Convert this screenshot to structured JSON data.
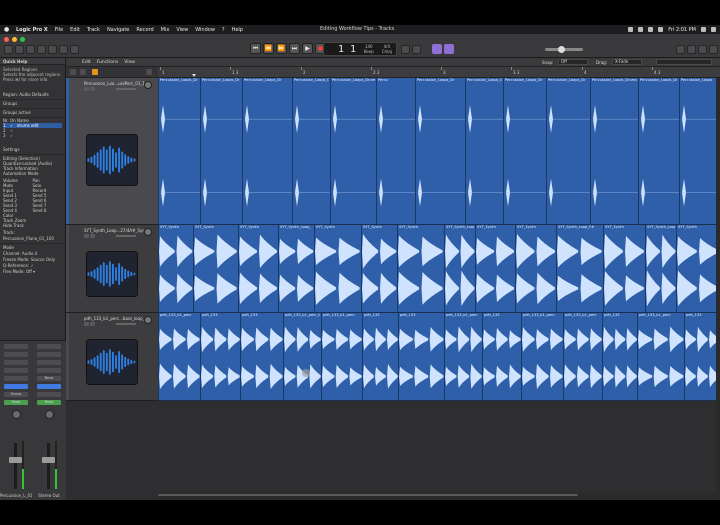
{
  "menubar": {
    "app": "Logic Pro X",
    "items": [
      "File",
      "Edit",
      "Track",
      "Navigate",
      "Record",
      "Mix",
      "View",
      "Window",
      "?",
      "Help"
    ],
    "window_title": "Editing Workflow Tips - Tracks",
    "clock": "Fri 2:01 PM"
  },
  "transport": {
    "position": "1  1",
    "bpm": "140",
    "bpm_sub": "Keep",
    "sig": "4/4",
    "key": "Cmaj",
    "buttons": [
      "⏮",
      "⏪",
      "⏩",
      "⏭",
      "▶",
      "●",
      "⟲"
    ]
  },
  "inspector": {
    "quick_help_title": "Quick Help",
    "quick_help_lines": [
      "Selected Regions",
      "Selects the adjacent regions.",
      "Press ⌘/ for more info."
    ],
    "region_title": "Region: Audio Defaults",
    "groups_title": "Groups",
    "groups_active": "Groups active",
    "groups_cols": [
      "Nr.",
      "On",
      "Name"
    ],
    "groups_rows": [
      {
        "nr": "1",
        "on": "✓",
        "name": "drums edit"
      },
      {
        "nr": "2",
        "on": "✓",
        "name": ""
      },
      {
        "nr": "3",
        "on": "✓",
        "name": ""
      }
    ],
    "settings_title": "Settings",
    "settings_items": [
      "Editing (Selection)",
      "Quantize-Locked (Audio)",
      "",
      "Track Information",
      "",
      "Automation Mode"
    ],
    "params": [
      "Volume",
      "Pan",
      "Mute",
      "Solo",
      "Input",
      "Record",
      "Send 1",
      "Send 5",
      "Send 2",
      "Send 6",
      "Send 3",
      "Send 7",
      "Send 4",
      "Send 8",
      "Color",
      "",
      "Track Zoom",
      "",
      "Hide Track",
      ""
    ],
    "track_title": "Track:  Percussion_Piano_01_100",
    "mode_label": "Mode",
    "channel_label": "Channel: Audio 4",
    "freeze_label": "Freeze Mode: Source Only",
    "q_reference": "Q-Reference: ✓",
    "flex_label": "Flex Mode: Off ▾",
    "strip1_name": "Percussion_L_01_100",
    "strip2_name": "Stereo Out",
    "strip_read": "Read",
    "strip_bounce": "Bnce",
    "strip_group": "Group"
  },
  "tracks_toolbar": {
    "menus": [
      "Edit",
      "Functions",
      "View"
    ],
    "snap_label": "Snap:",
    "snap_value": "Off",
    "drag_label": "Drag:",
    "drag_value": "X-Fade"
  },
  "ruler": {
    "labels": [
      "1",
      "1 3",
      "2",
      "2 3",
      "3",
      "3 3",
      "4",
      "4 3"
    ]
  },
  "tracks": [
    {
      "name": "Percussion_Loo...ussPerc_01_100",
      "region_names": [
        "Percussion_Loops_Dr",
        "Percussion_Loops_Dr",
        "Percussion_Loops_Dr",
        "Percussion_Loops_DrumsPerc_",
        "Percussion_Loops_DrumsPerc_01_100",
        "Percu",
        "Percussion_Loops_Dr",
        "Percussion_Loops_Dr",
        "Percussion_Loops_Dr",
        "Percussion_Loops_Dr",
        "Percussion_Loops_DrumsPerc_01_100",
        "Percussion_Loops_Dr",
        "Percussion_Loops"
      ]
    },
    {
      "name": "SYT_Synth_Loop...27/4A#_Synthloop",
      "region_names": [
        "SYT_Synth",
        "SYT_Synth",
        "SYT_Synth",
        "SYT_Synth_Loop_",
        "SYT_Synth",
        "SYT_Synth",
        "SYT_Synth",
        "SYT_Synth_Loop_",
        "SYT_Synth",
        "SYT_Synth",
        "SYT_Synth_Loop_F#",
        "SYT_Synth",
        "SYT_Synth_Loop_",
        "SYT_Synth"
      ]
    },
    {
      "name": "pdh_133_b1_perc...bass_loop_Cmin",
      "region_names": [
        "pdh_133_b1_perc",
        "pdh_133",
        "pdh_133",
        "pdh_133_b1_perc_bass_loo",
        "pdh_133_b1_perc",
        "pdh_133",
        "pdh_133",
        "pdh_133_b1_perc",
        "pdh_133",
        "pdh_133_b1_perc",
        "pdh_133_b1_perc",
        "pdh_133",
        "pdh_133_b1_perc",
        "pdh_133"
      ]
    }
  ],
  "colors": {
    "region": "#2f5fa8",
    "waveform": "#cfe3ff",
    "selected_track": "#2f5ea5",
    "record": "#ff3b30",
    "purple": "#8e6fd6",
    "orange": "#e8931f"
  },
  "icons": {
    "waveform_icon": "waveform-icon",
    "apple": "apple-logo-icon"
  }
}
